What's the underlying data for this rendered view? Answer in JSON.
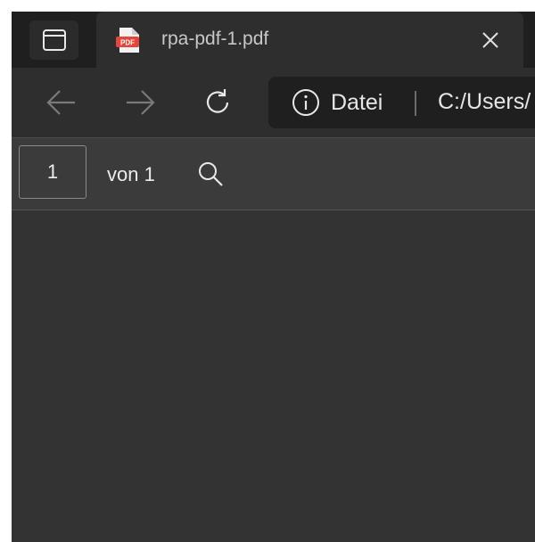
{
  "tab": {
    "title": "rpa-pdf-1.pdf",
    "favicon_label": "PDF"
  },
  "address_bar": {
    "site_info_label": "Datei",
    "url": "C:/Users/"
  },
  "pdf_toolbar": {
    "page_value": "1",
    "page_count": "von 1"
  },
  "colors": {
    "window_bg": "#1f1f1f",
    "tab_bg": "#2e2e2e",
    "pdf_toolbar_bg": "#3b3b3b",
    "viewer_bg": "#333333",
    "pdf_icon_red": "#e5463c"
  },
  "icons": {
    "tab_actions": "tab-actions-icon",
    "favicon": "pdf-file-icon",
    "close": "close-icon",
    "back": "arrow-left-icon",
    "forward": "arrow-right-icon",
    "refresh": "refresh-icon",
    "info": "info-icon",
    "search": "search-icon"
  }
}
